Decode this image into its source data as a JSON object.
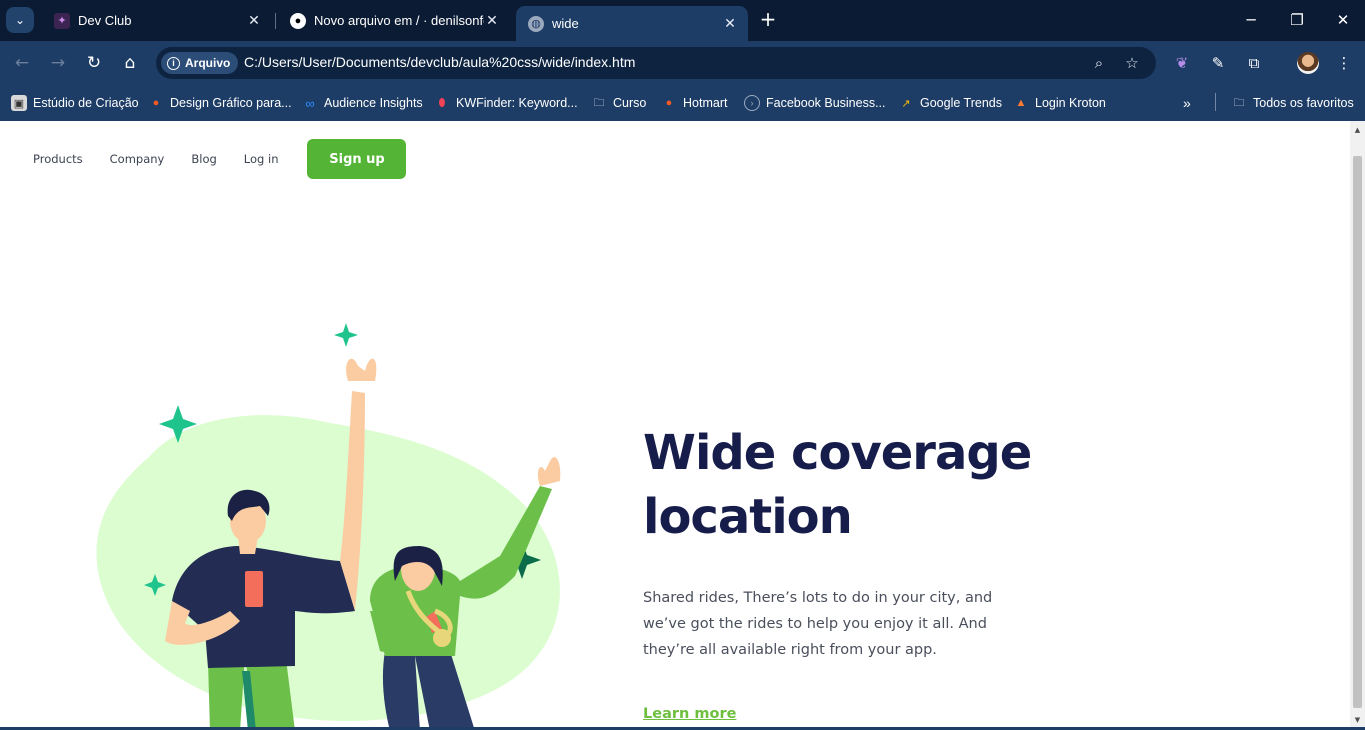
{
  "browser": {
    "tabs": [
      {
        "title": "Dev Club",
        "icon": "dev-club-icon",
        "active": false
      },
      {
        "title": "Novo arquivo em / · denilsonfe",
        "icon": "github-icon",
        "active": false
      },
      {
        "title": "wide",
        "icon": "globe-icon",
        "active": true
      }
    ],
    "address": {
      "chip_label": "Arquivo",
      "url": "C:/Users/User/Documents/devclub/aula%20css/wide/index.htm"
    },
    "bookmarks": [
      {
        "label": "Estúdio de Criação",
        "icon": "studio-icon"
      },
      {
        "label": "Design Gráfico para...",
        "icon": "hotmart-flame-icon"
      },
      {
        "label": "Audience Insights",
        "icon": "meta-icon"
      },
      {
        "label": "KWFinder: Keyword...",
        "icon": "kwfinder-icon"
      },
      {
        "label": "Curso",
        "icon": "folder-icon"
      },
      {
        "label": "Hotmart",
        "icon": "hotmart-flame-icon"
      },
      {
        "label": "Facebook Business...",
        "icon": "facebook-business-icon"
      },
      {
        "label": "Google Trends",
        "icon": "trends-icon"
      },
      {
        "label": "Login Kroton",
        "icon": "kroton-icon"
      }
    ],
    "all_bookmarks_label": "Todos os favoritos"
  },
  "page": {
    "nav": {
      "items": [
        "Products",
        "Company",
        "Blog",
        "Log in"
      ],
      "signup_label": "Sign up"
    },
    "hero": {
      "heading": "Wide coverage location",
      "description": "Shared rides, There’s lots to do in your city, and we’ve got the rides to help you enjoy it all. And they’re all available right from your app.",
      "cta": "Learn more"
    },
    "colors": {
      "accent_green": "#54b435",
      "heading_navy": "#171d4a",
      "blob_green": "#dcfdd0"
    }
  }
}
